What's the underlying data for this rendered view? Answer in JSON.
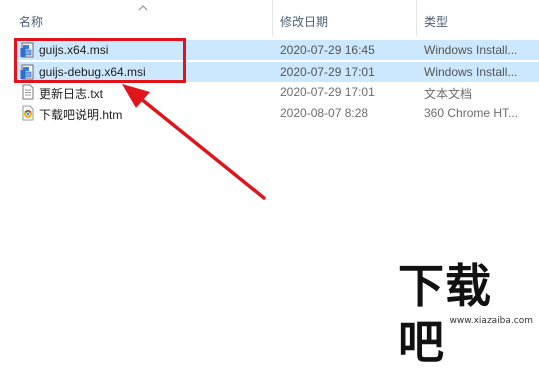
{
  "columns": {
    "name": "名称",
    "date": "修改日期",
    "type": "类型"
  },
  "files": [
    {
      "name": "guijs.x64.msi",
      "date": "2020-07-29 16:45",
      "type": "Windows Install...",
      "icon": "msi-installer-icon",
      "selected": true
    },
    {
      "name": "guijs-debug.x64.msi",
      "date": "2020-07-29 17:01",
      "type": "Windows Install...",
      "icon": "msi-installer-icon",
      "selected": true
    },
    {
      "name": "更新日志.txt",
      "date": "2020-07-29 17:01",
      "type": "文本文档",
      "icon": "text-document-icon",
      "selected": false
    },
    {
      "name": "下载吧说明.htm",
      "date": "2020-08-07 8:28",
      "type": "360 Chrome HT...",
      "icon": "browser-html-icon",
      "selected": false
    }
  ],
  "annotation": {
    "box_color": "#e1141c",
    "arrow_color": "#e1141c"
  },
  "watermark": {
    "logo_text": "下载吧",
    "url": "www.xiazaiba.com"
  },
  "colors": {
    "selection": "#cce8ff",
    "header_text": "#4c607a"
  }
}
